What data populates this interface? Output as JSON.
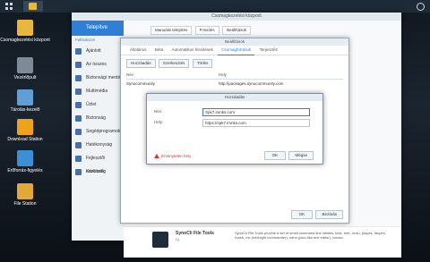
{
  "desktop": {
    "icons": [
      {
        "label": "Csomagkezelési központ",
        "color": "#e9b73a"
      },
      {
        "label": "Vezérlőpult",
        "color": "#7d8a98"
      },
      {
        "label": "Tárolás-kezelő",
        "color": "#5f9fd6"
      },
      {
        "label": "Download Station",
        "color": "#f0a21c"
      },
      {
        "label": "Erőforrás-figyelés",
        "color": "#3c8fd4"
      },
      {
        "label": "File Station",
        "color": "#e2a93a"
      }
    ]
  },
  "window": {
    "title": "Csomagkezelési központ",
    "sidebar": {
      "header": "Telepítve",
      "category": "Felfedezés",
      "items": [
        "Ajánlott",
        "Az összes",
        "Biztonsági mentés",
        "Multimédia",
        "Üzlet",
        "Biztonság",
        "Segédprogramok",
        "Hatékonyság",
        "Fejlesztői eszközök",
        "Közösség"
      ]
    },
    "toolbar": {
      "buttons": [
        "Manuális telepítés",
        "Frissítés",
        "Beállítások"
      ]
    },
    "package_footer": {
      "name": "SynoCli File Tools",
      "badge": "Új",
      "description": "SynoCli File Tools provide a set of small command-line utilities: less, tree, ncdu, jdupes, fdupes, rhash, mc (midnight commander), nano (pico-like text editor), nanorc"
    }
  },
  "settings_dialog": {
    "title": "Beállítások",
    "tabs": [
      "Általános",
      "Béta",
      "Automatikus frissítések",
      "Csomagforrások",
      "Terjesztés"
    ],
    "active_tab": "Csomagforrások",
    "actions": [
      "Hozzáadás",
      "Szerkesztés",
      "Törlés"
    ],
    "columns": [
      "Név",
      "Hely"
    ],
    "rows": [
      {
        "name": "Synocommunity",
        "url": "http://packages.synocommunity.com"
      }
    ],
    "footer_buttons": [
      "OK",
      "Bezárás"
    ]
  },
  "add_dialog": {
    "title": "Hozzáadás",
    "name_label": "Név:",
    "name_value": "Spk7.imnks.com",
    "location_label": "Hely:",
    "location_value": "https://spk7.imnks.com",
    "status_text": "Érvénytelen hely",
    "buttons": [
      "OK",
      "Mégse"
    ]
  }
}
